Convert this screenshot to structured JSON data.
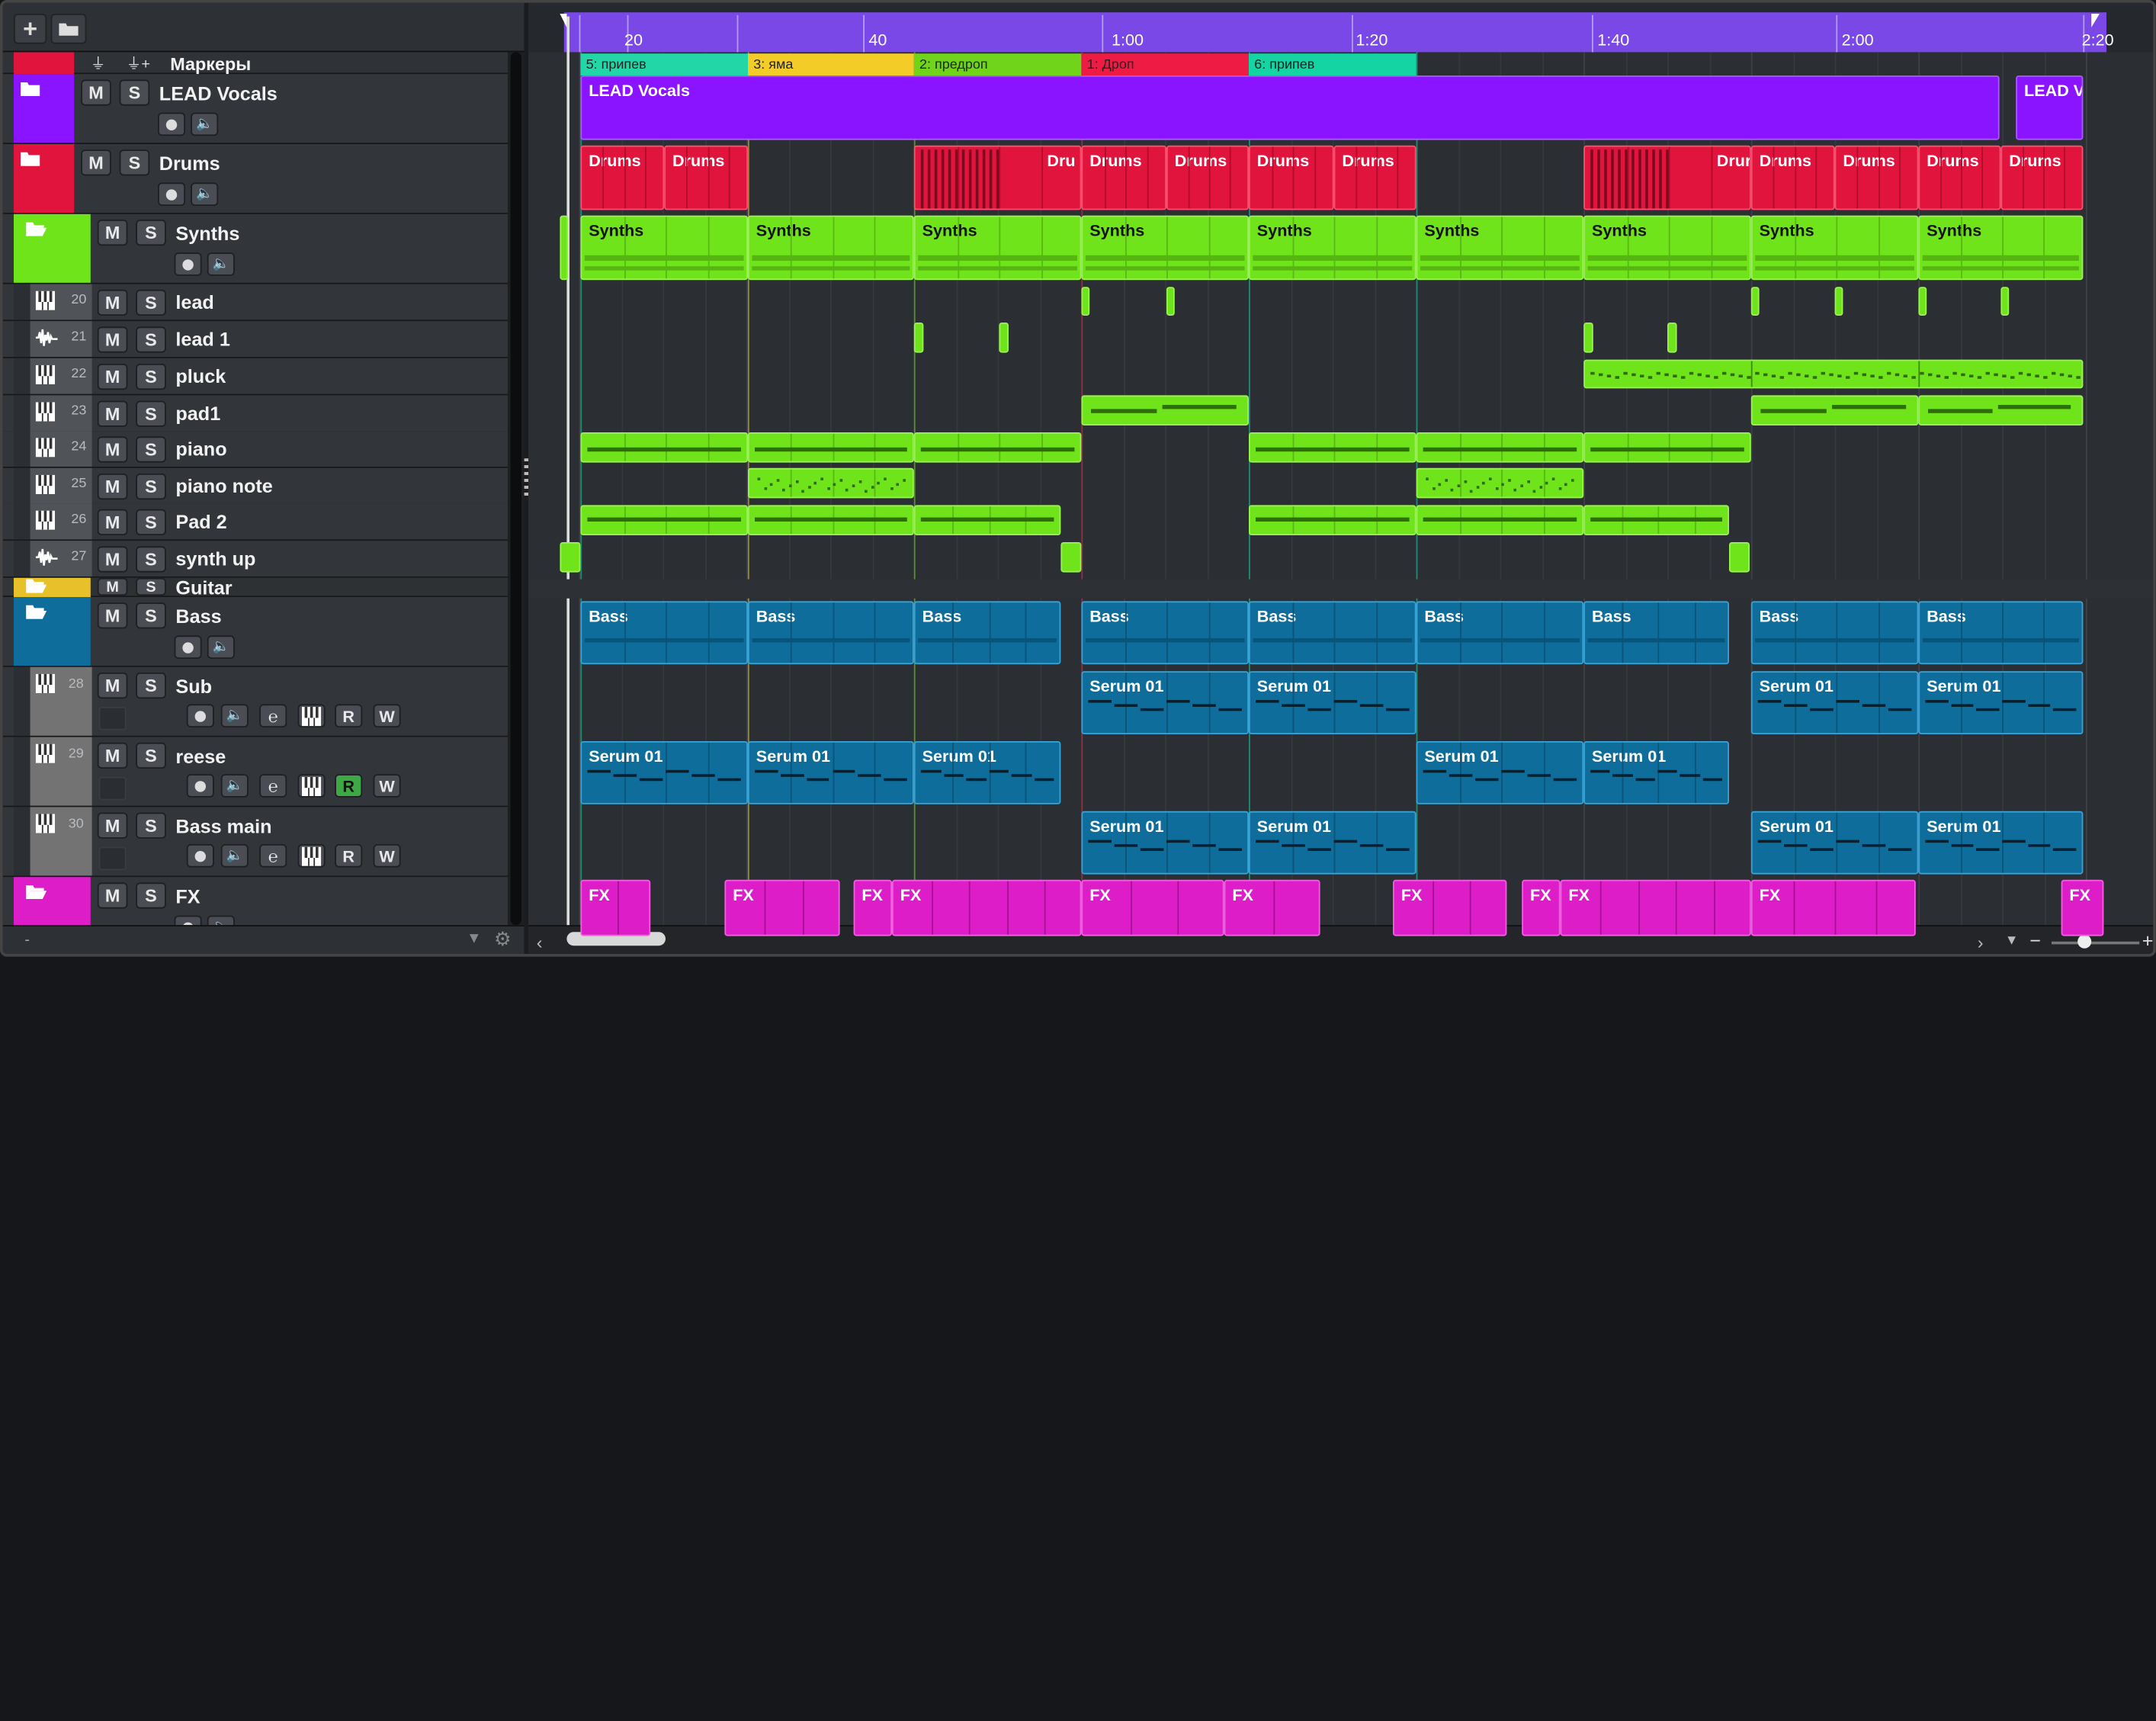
{
  "toolbar": {
    "add_icon": "plus-icon",
    "add_folder_icon": "folder-icon",
    "markers_label": "Маркеры",
    "marker_icon_1": "filter-icon",
    "marker_icon_2": "marker-filter-icon"
  },
  "tracks": [
    {
      "id": "lead_vocals",
      "name": "LEAD Vocals",
      "type": "folder",
      "color": "#8a14ff"
    },
    {
      "id": "drums",
      "name": "Drums",
      "type": "folder",
      "color": "#e0143c"
    },
    {
      "id": "synths",
      "name": "Synths",
      "type": "folder",
      "color": "#6fe41a"
    },
    {
      "id": "lead",
      "num": "20",
      "name": "lead",
      "type": "instrument"
    },
    {
      "id": "lead1",
      "num": "21",
      "name": "lead 1",
      "type": "audio"
    },
    {
      "id": "pluck",
      "num": "22",
      "name": "pluck",
      "type": "instrument"
    },
    {
      "id": "pad1",
      "num": "23",
      "name": "pad1",
      "type": "instrument"
    },
    {
      "id": "piano",
      "num": "24",
      "name": "piano",
      "type": "instrument"
    },
    {
      "id": "pianonote",
      "num": "25",
      "name": "piano note",
      "type": "instrument"
    },
    {
      "id": "pad2",
      "num": "26",
      "name": "Pad 2",
      "type": "instrument"
    },
    {
      "id": "synthup",
      "num": "27",
      "name": "synth up",
      "type": "audio"
    },
    {
      "id": "guitar",
      "name": "Guitar",
      "type": "folder",
      "color": "#e8c02a"
    },
    {
      "id": "bass",
      "name": "Bass",
      "type": "folder",
      "color": "#0f6d9c"
    },
    {
      "id": "sub",
      "num": "28",
      "name": "Sub",
      "type": "instrument"
    },
    {
      "id": "reese",
      "num": "29",
      "name": "reese",
      "type": "instrument"
    },
    {
      "id": "bassmain",
      "num": "30",
      "name": "Bass main",
      "type": "instrument"
    },
    {
      "id": "fx",
      "name": "FX",
      "type": "folder",
      "color": "#dd1ec8"
    }
  ],
  "buttons": {
    "mute": "M",
    "solo": "S",
    "record": "R",
    "write": "W"
  },
  "ruler": {
    "labels": [
      "20",
      "40",
      "1:00",
      "1:20",
      "1:40",
      "2:00",
      "2:20"
    ]
  },
  "markers": [
    "5: припев",
    "3: яма",
    "2: предроп",
    "1: Дроп",
    "6: припев"
  ],
  "clip_labels": {
    "lead_vocals": "LEAD Vocals",
    "lead_vocals_tail": "LEAD V",
    "drums": "Drums",
    "drums_short": "Drur",
    "drums_short2": "Dru",
    "synths": "Synths",
    "bass": "Bass",
    "serum": "Serum 01",
    "fx": "FX"
  },
  "footer": {
    "left_label": "-"
  },
  "colors": {
    "lead_vocals": "#8a14ff",
    "drums": "#e0143c",
    "synths": "#6fe41a",
    "bass": "#0f6d9c",
    "fx": "#dd1ec8",
    "guitar": "#e8c02a",
    "ruler": "#7a48e6"
  }
}
